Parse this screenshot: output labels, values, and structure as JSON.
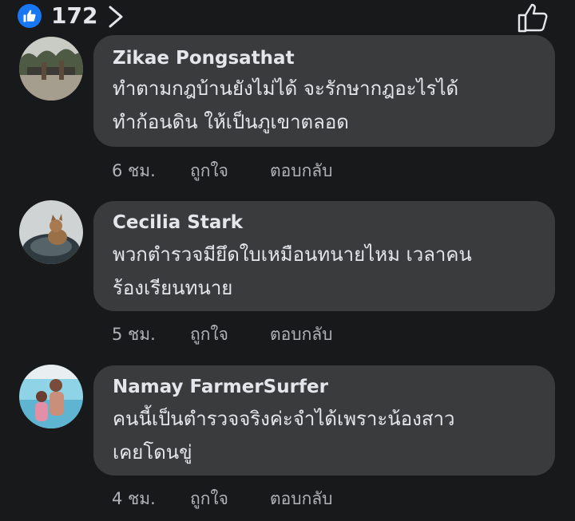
{
  "reactions": {
    "count": "172",
    "like_icon": "thumbs-up-icon",
    "chevron_icon": "chevron-right-icon",
    "react_icon": "thumbs-up-outline-icon",
    "accent": "#1877f2"
  },
  "comments": [
    {
      "author": "Zikae Pongsathat",
      "text_line1": "ทำตามกฎบ้านยังไม่ได้ จะรักษากฎอะไรได้",
      "text_line2": "ทำก้อนดิน ให้เป็นภูเขาตลอด",
      "time": "6 ชม.",
      "like_label": "ถูกใจ",
      "reply_label": "ตอบกลับ"
    },
    {
      "author": "Cecilia Stark",
      "text_line1": "พวกตำรวจมียึดใบเหมือนทนายไหม เวลาคน",
      "text_line2": "ร้องเรียนทนาย",
      "time": "5 ชม.",
      "like_label": "ถูกใจ",
      "reply_label": "ตอบกลับ"
    },
    {
      "author": "Namay FarmerSurfer",
      "text_line1": "คนนี้เป็นตำรวจจริงค่ะจำได้เพราะน้องสาว",
      "text_line2": "เคยโดนขู่",
      "time": "4 ชม.",
      "like_label": "ถูกใจ",
      "reply_label": "ตอบกลับ"
    }
  ],
  "colors": {
    "background": "#18191a",
    "bubble": "#3a3b3c",
    "primary_text": "#e4e6eb",
    "secondary_text": "#b0b3b8"
  }
}
